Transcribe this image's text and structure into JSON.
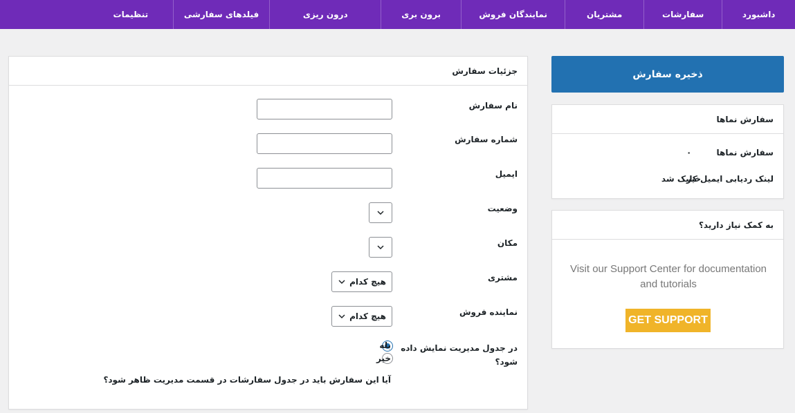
{
  "nav": {
    "items": [
      {
        "label": "داشبورد"
      },
      {
        "label": "سفارشات"
      },
      {
        "label": "مشتریان"
      },
      {
        "label": "نمایندگان فروش"
      },
      {
        "label": "برون بری"
      },
      {
        "label": "درون ریزی"
      },
      {
        "label": "فیلدهای سفارشی"
      },
      {
        "label": "تنظیمات"
      }
    ]
  },
  "sidebar": {
    "save_label": "ذخیره سفارش",
    "summary": {
      "title": "سفارش نماها",
      "rows": [
        {
          "label": "سفارش نماها",
          "value": "۰"
        },
        {
          "label": "لینک ردیابی ایمیل کلیک شد",
          "value": "خیر"
        }
      ]
    },
    "help": {
      "title": "به کمک نیاز دارید؟",
      "text": "Visit our Support Center for documentation and tutorials",
      "button_label": "GET SUPPORT",
      "button_color": "#f0b429"
    }
  },
  "main": {
    "title": "جزئیات سفارش",
    "fields": {
      "order_name": {
        "label": "نام سفارش",
        "value": ""
      },
      "order_number": {
        "label": "شماره سفارش",
        "value": ""
      },
      "email": {
        "label": "ایمیل",
        "value": ""
      },
      "status": {
        "label": "وضعیت",
        "value": ""
      },
      "location": {
        "label": "مکان",
        "value": ""
      },
      "customer": {
        "label": "مشتری",
        "value": "هیچ کدام"
      },
      "sales_rep": {
        "label": "نماینده فروش",
        "value": "هیچ کدام"
      }
    },
    "show_in_table": {
      "label_line1": "در جدول مدیریت نمایش داده",
      "label_line2": "شود؟",
      "options": [
        {
          "label": "بله",
          "selected": true
        },
        {
          "label": "خیر",
          "selected": false
        }
      ],
      "help": "آیا این سفارش باید در جدول سفارشات در قسمت مدیریت ظاهر شود؟"
    }
  },
  "colors": {
    "nav_bg": "#6f2bb8",
    "primary": "#2271b1",
    "page_bg": "#f0f0f1"
  }
}
